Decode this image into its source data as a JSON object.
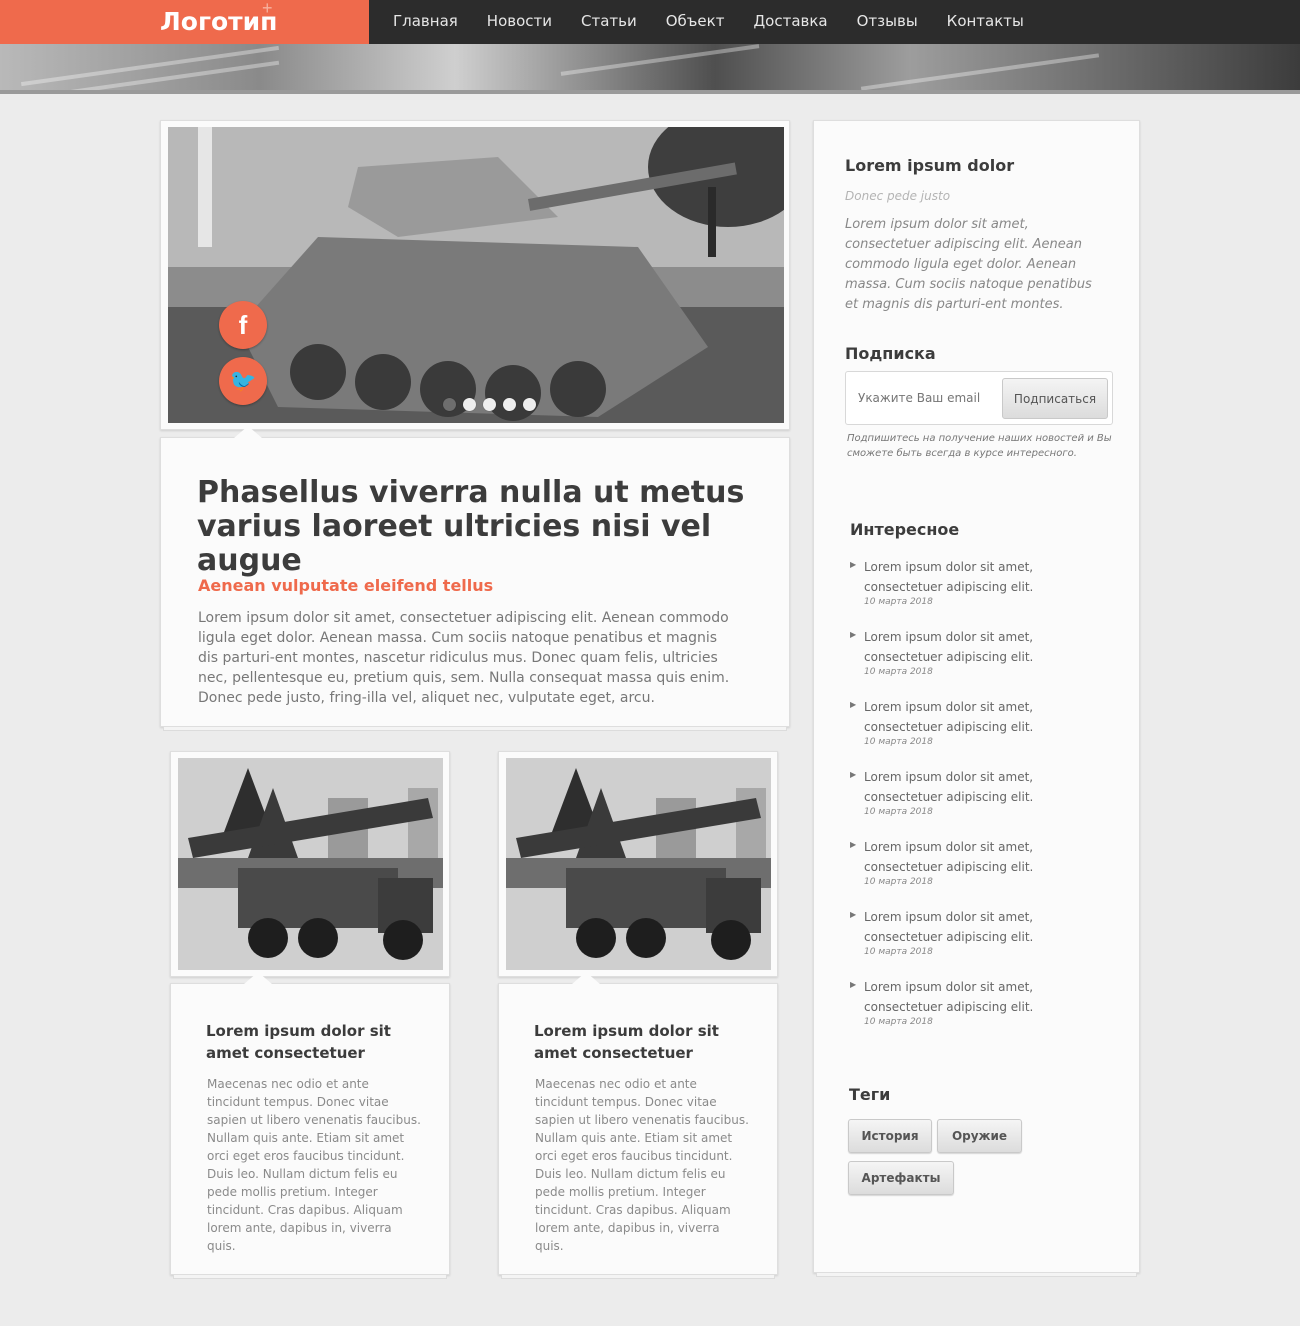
{
  "header": {
    "logo": "Логотип",
    "logo_plus": "+",
    "nav": [
      "Главная",
      "Новости",
      "Статьи",
      "Объект",
      "Доставка",
      "Отзывы",
      "Контакты"
    ]
  },
  "slider": {
    "social": {
      "facebook": "f",
      "twitter": "🐦"
    },
    "dots_total": 5,
    "dots_active_index": 0
  },
  "article": {
    "title": "Phasellus viverra nulla ut metus varius laoreet ultricies nisi vel augue",
    "subtitle": "Aenean vulputate eleifend tellus",
    "body": "Lorem ipsum dolor sit amet, consectetuer adipiscing elit. Aenean commodo ligula eget dolor. Aenean massa. Cum sociis natoque penatibus et magnis dis parturi-ent montes, nascetur ridiculus mus. Donec quam felis, ultricies nec, pellentesque eu, pretium quis, sem. Nulla consequat massa quis enim. Donec pede justo, fring-illa vel, aliquet nec, vulputate eget, arcu."
  },
  "cards": [
    {
      "title": "Lorem ipsum dolor sit amet consectetuer",
      "body": "Maecenas nec odio et ante tincidunt tempus. Donec vitae sapien ut libero venenatis faucibus. Nullam quis ante. Etiam sit amet orci eget eros faucibus tincidunt. Duis leo. Nullam dictum felis eu pede mollis pretium. Integer tincidunt. Cras dapibus. Aliquam lorem ante, dapibus in, viverra quis."
    },
    {
      "title": "Lorem ipsum dolor sit amet consectetuer",
      "body": "Maecenas nec odio et ante tincidunt tempus. Donec vitae sapien ut libero venenatis faucibus. Nullam quis ante. Etiam sit amet orci eget eros faucibus tincidunt. Duis leo. Nullam dictum felis eu pede mollis pretium. Integer tincidunt. Cras dapibus. Aliquam lorem ante, dapibus in, viverra quis."
    }
  ],
  "sidebar": {
    "about_title": "Lorem ipsum dolor",
    "about_sub": "Donec pede justo",
    "about_text": "Lorem ipsum dolor sit amet, consectetuer adipiscing elit. Aenean commodo ligula eget dolor. Aenean massa. Cum sociis natoque penatibus et magnis dis parturi-ent montes.",
    "subscribe_title": "Подписка",
    "subscribe_placeholder": "Укажите Ваш email",
    "subscribe_button": "Подписаться",
    "subscribe_note": "Подпишитесь на получение наших новостей и Вы сможете быть всегда в курсе интересного.",
    "interest_title": "Интересное",
    "interest_items": [
      {
        "text": "Lorem ipsum dolor sit amet, consectetuer adipiscing elit.",
        "date": "10 марта 2018"
      },
      {
        "text": "Lorem ipsum dolor sit amet, consectetuer adipiscing elit.",
        "date": "10 марта 2018"
      },
      {
        "text": "Lorem ipsum dolor sit amet, consectetuer adipiscing elit.",
        "date": "10 марта 2018"
      },
      {
        "text": "Lorem ipsum dolor sit amet, consectetuer adipiscing elit.",
        "date": "10 марта 2018"
      },
      {
        "text": "Lorem ipsum dolor sit amet, consectetuer adipiscing elit.",
        "date": "10 марта 2018"
      },
      {
        "text": "Lorem ipsum dolor sit amet, consectetuer adipiscing elit.",
        "date": "10 марта 2018"
      },
      {
        "text": "Lorem ipsum dolor sit amet, consectetuer adipiscing elit.",
        "date": "10 марта 2018"
      }
    ],
    "tags_title": "Теги",
    "tags": [
      "История",
      "Оружие",
      "Артефакты"
    ]
  },
  "colors": {
    "accent": "#ef6a4c",
    "topbar": "#2c2c2c",
    "background": "#ececec"
  }
}
